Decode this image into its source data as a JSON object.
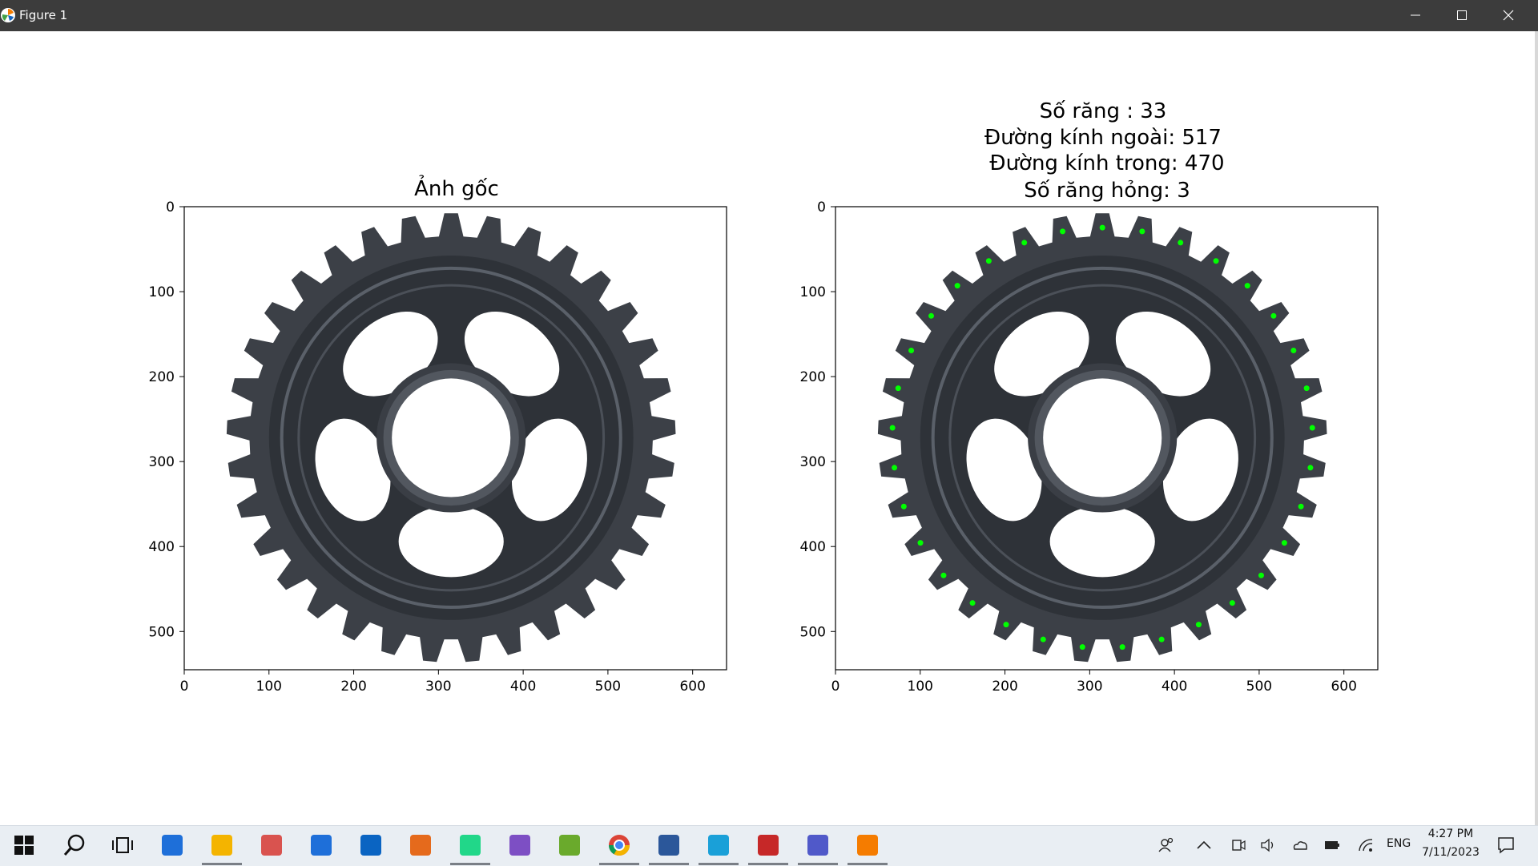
{
  "window": {
    "title": "Figure 1",
    "minimize_icon": "minimize-icon",
    "maximize_icon": "maximize-icon",
    "close_icon": "close-icon"
  },
  "left_axes": {
    "title": "Ảnh gốc",
    "xticks": [
      "0",
      "100",
      "200",
      "300",
      "400",
      "500",
      "600"
    ],
    "yticks": [
      "0",
      "100",
      "200",
      "300",
      "400",
      "500"
    ],
    "image": "gear-image"
  },
  "right_axes": {
    "title_lines": [
      "Số răng : 33",
      "Đường kính ngoài: 517",
      "Đường kính trong: 470",
      "Số răng hỏng: 3"
    ],
    "xticks": [
      "0",
      "100",
      "200",
      "300",
      "400",
      "500",
      "600"
    ],
    "yticks": [
      "0",
      "100",
      "200",
      "300",
      "400",
      "500"
    ],
    "image": "gear-image-annotated",
    "marker_color": "#00ff00"
  },
  "taskbar": {
    "icons": [
      "windows-start-icon",
      "search-icon",
      "task-view-icon",
      "microsoft-store-icon",
      "file-explorer-icon",
      "snipping-tool-icon",
      "mail-icon",
      "outlook-icon",
      "matlab-icon",
      "pycharm-icon",
      "visual-studio-icon",
      "coccoc-icon",
      "chrome-icon",
      "word-icon",
      "edge-icon",
      "solidworks-icon",
      "teams-icon",
      "matplotlib-icon"
    ],
    "tray_icons": [
      "people-icon",
      "chevron-up-icon",
      "meet-now-icon",
      "volume-icon",
      "onedrive-icon",
      "battery-icon",
      "wifi-icon"
    ],
    "language": "ENG",
    "time": "4:27 PM",
    "date": "7/11/2023",
    "notification_icon": "notification-icon"
  }
}
